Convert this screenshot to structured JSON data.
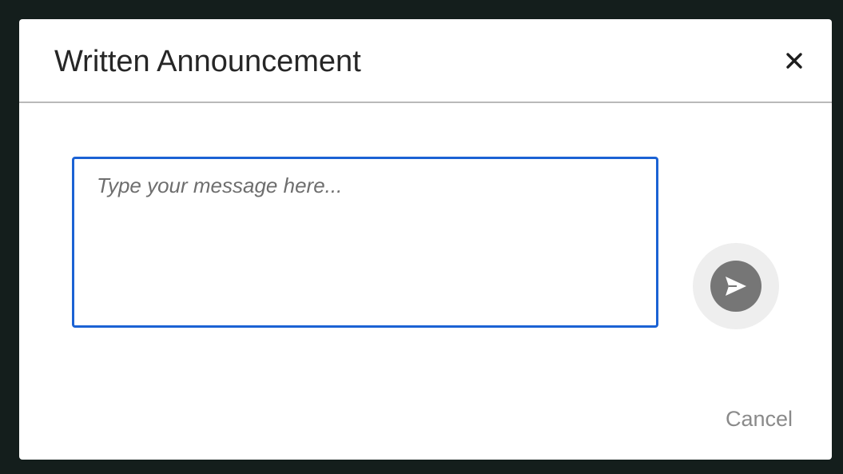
{
  "modal": {
    "title": "Written Announcement",
    "close_icon": "close-icon",
    "message": {
      "value": "",
      "placeholder": "Type your message here..."
    },
    "send_icon": "send-icon",
    "cancel_label": "Cancel"
  },
  "colors": {
    "backdrop": "#141e1c",
    "input_border": "#1b62d4",
    "send_button": "#767676",
    "send_button_halo": "#eeeeee",
    "cancel_text": "#8a8a8a"
  }
}
